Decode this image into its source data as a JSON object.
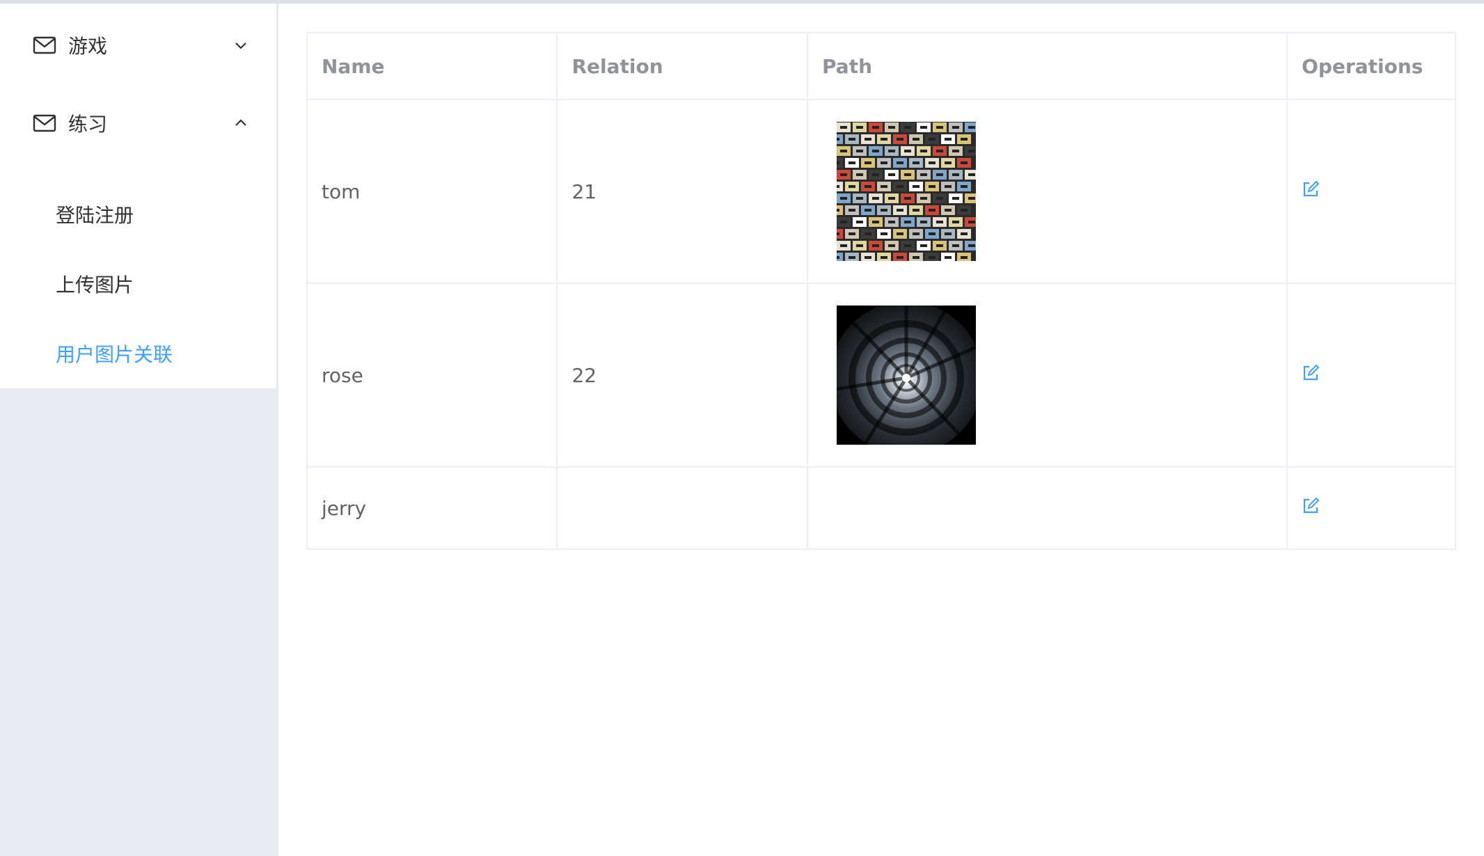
{
  "sidebar": {
    "groups": [
      {
        "label": "游戏",
        "icon": "mail-icon",
        "expanded": false,
        "chevron": "chevron-down-icon"
      },
      {
        "label": "练习",
        "icon": "mail-icon",
        "expanded": true,
        "chevron": "chevron-up-icon"
      }
    ],
    "items": [
      {
        "label": "登陆注册",
        "active": false
      },
      {
        "label": "上传图片",
        "active": false
      },
      {
        "label": "用户图片关联",
        "active": true
      }
    ],
    "active_color": "#409eff"
  },
  "table": {
    "columns": [
      "Name",
      "Relation",
      "Path",
      "Operations"
    ],
    "rows": [
      {
        "name": "tom",
        "relation": "21",
        "image": "cassette-tapes-thumbnail",
        "operation_icon": "edit-icon"
      },
      {
        "name": "rose",
        "relation": "22",
        "image": "tunnel-spiral-thumbnail",
        "operation_icon": "edit-icon"
      },
      {
        "name": "jerry",
        "relation": "",
        "image": "",
        "operation_icon": "edit-icon"
      }
    ]
  }
}
